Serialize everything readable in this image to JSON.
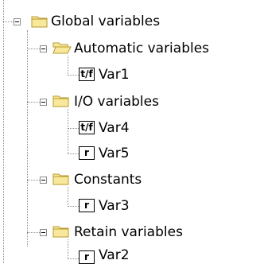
{
  "tree": {
    "root": {
      "label": "Global variables",
      "icon": "folder-closed-icon",
      "expanded": true,
      "groups": [
        {
          "label": "Automatic variables",
          "icon": "folder-open-icon",
          "expanded": true,
          "children": [
            {
              "label": "Var1",
              "icon_text": "t/f"
            }
          ]
        },
        {
          "label": "I/O variables",
          "icon": "folder-closed-icon",
          "expanded": true,
          "children": [
            {
              "label": "Var4",
              "icon_text": "t/f"
            },
            {
              "label": "Var5",
              "icon_text": "r"
            }
          ]
        },
        {
          "label": "Constants",
          "icon": "folder-closed-icon",
          "expanded": true,
          "children": [
            {
              "label": "Var3",
              "icon_text": "r"
            }
          ]
        },
        {
          "label": "Retain variables",
          "icon": "folder-closed-icon",
          "expanded": true,
          "children": [
            {
              "label": "Var2",
              "icon_text": "r"
            }
          ]
        }
      ]
    }
  },
  "colors": {
    "folder_fill": "#f7e89c",
    "folder_edge": "#b89a2c",
    "tree_line": "#8c8c8c"
  }
}
